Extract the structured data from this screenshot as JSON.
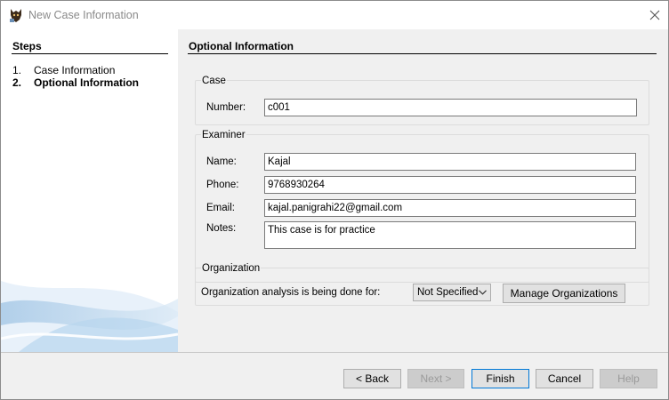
{
  "window": {
    "title": "New Case Information",
    "close_glyph": "×"
  },
  "steps": {
    "heading": "Steps",
    "items": [
      {
        "number": "1.",
        "label": "Case Information"
      },
      {
        "number": "2.",
        "label": "Optional Information"
      }
    ]
  },
  "main": {
    "heading": "Optional Information",
    "case": {
      "legend": "Case",
      "number_label": "Number:",
      "number_value": "c001"
    },
    "examiner": {
      "legend": "Examiner",
      "name_label": "Name:",
      "name_value": "Kajal",
      "phone_label": "Phone:",
      "phone_value": "9768930264",
      "email_label": "Email:",
      "email_value": "kajal.panigrahi22@gmail.com",
      "notes_label": "Notes:",
      "notes_value": "This case is for practice"
    },
    "organization": {
      "legend": "Organization",
      "analysis_label": "Organization analysis is being done for:",
      "selected": "Not Specified",
      "manage_label": "Manage Organizations"
    }
  },
  "footer": {
    "back": "< Back",
    "next": "Next >",
    "finish": "Finish",
    "cancel": "Cancel",
    "help": "Help"
  },
  "icons": {
    "app": "autopsy-dog-icon",
    "close": "close-icon",
    "dropdown": "chevron-down-icon"
  }
}
